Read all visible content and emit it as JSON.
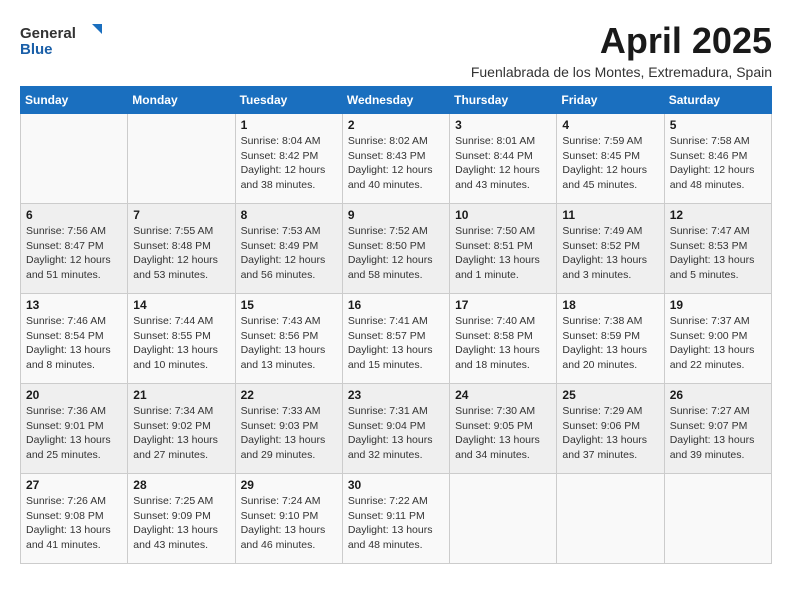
{
  "header": {
    "logo_general": "General",
    "logo_blue": "Blue",
    "month_title": "April 2025",
    "location": "Fuenlabrada de los Montes, Extremadura, Spain"
  },
  "weekdays": [
    "Sunday",
    "Monday",
    "Tuesday",
    "Wednesday",
    "Thursday",
    "Friday",
    "Saturday"
  ],
  "weeks": [
    [
      {
        "day": "",
        "info": ""
      },
      {
        "day": "",
        "info": ""
      },
      {
        "day": "1",
        "info": "Sunrise: 8:04 AM\nSunset: 8:42 PM\nDaylight: 12 hours and 38 minutes."
      },
      {
        "day": "2",
        "info": "Sunrise: 8:02 AM\nSunset: 8:43 PM\nDaylight: 12 hours and 40 minutes."
      },
      {
        "day": "3",
        "info": "Sunrise: 8:01 AM\nSunset: 8:44 PM\nDaylight: 12 hours and 43 minutes."
      },
      {
        "day": "4",
        "info": "Sunrise: 7:59 AM\nSunset: 8:45 PM\nDaylight: 12 hours and 45 minutes."
      },
      {
        "day": "5",
        "info": "Sunrise: 7:58 AM\nSunset: 8:46 PM\nDaylight: 12 hours and 48 minutes."
      }
    ],
    [
      {
        "day": "6",
        "info": "Sunrise: 7:56 AM\nSunset: 8:47 PM\nDaylight: 12 hours and 51 minutes."
      },
      {
        "day": "7",
        "info": "Sunrise: 7:55 AM\nSunset: 8:48 PM\nDaylight: 12 hours and 53 minutes."
      },
      {
        "day": "8",
        "info": "Sunrise: 7:53 AM\nSunset: 8:49 PM\nDaylight: 12 hours and 56 minutes."
      },
      {
        "day": "9",
        "info": "Sunrise: 7:52 AM\nSunset: 8:50 PM\nDaylight: 12 hours and 58 minutes."
      },
      {
        "day": "10",
        "info": "Sunrise: 7:50 AM\nSunset: 8:51 PM\nDaylight: 13 hours and 1 minute."
      },
      {
        "day": "11",
        "info": "Sunrise: 7:49 AM\nSunset: 8:52 PM\nDaylight: 13 hours and 3 minutes."
      },
      {
        "day": "12",
        "info": "Sunrise: 7:47 AM\nSunset: 8:53 PM\nDaylight: 13 hours and 5 minutes."
      }
    ],
    [
      {
        "day": "13",
        "info": "Sunrise: 7:46 AM\nSunset: 8:54 PM\nDaylight: 13 hours and 8 minutes."
      },
      {
        "day": "14",
        "info": "Sunrise: 7:44 AM\nSunset: 8:55 PM\nDaylight: 13 hours and 10 minutes."
      },
      {
        "day": "15",
        "info": "Sunrise: 7:43 AM\nSunset: 8:56 PM\nDaylight: 13 hours and 13 minutes."
      },
      {
        "day": "16",
        "info": "Sunrise: 7:41 AM\nSunset: 8:57 PM\nDaylight: 13 hours and 15 minutes."
      },
      {
        "day": "17",
        "info": "Sunrise: 7:40 AM\nSunset: 8:58 PM\nDaylight: 13 hours and 18 minutes."
      },
      {
        "day": "18",
        "info": "Sunrise: 7:38 AM\nSunset: 8:59 PM\nDaylight: 13 hours and 20 minutes."
      },
      {
        "day": "19",
        "info": "Sunrise: 7:37 AM\nSunset: 9:00 PM\nDaylight: 13 hours and 22 minutes."
      }
    ],
    [
      {
        "day": "20",
        "info": "Sunrise: 7:36 AM\nSunset: 9:01 PM\nDaylight: 13 hours and 25 minutes."
      },
      {
        "day": "21",
        "info": "Sunrise: 7:34 AM\nSunset: 9:02 PM\nDaylight: 13 hours and 27 minutes."
      },
      {
        "day": "22",
        "info": "Sunrise: 7:33 AM\nSunset: 9:03 PM\nDaylight: 13 hours and 29 minutes."
      },
      {
        "day": "23",
        "info": "Sunrise: 7:31 AM\nSunset: 9:04 PM\nDaylight: 13 hours and 32 minutes."
      },
      {
        "day": "24",
        "info": "Sunrise: 7:30 AM\nSunset: 9:05 PM\nDaylight: 13 hours and 34 minutes."
      },
      {
        "day": "25",
        "info": "Sunrise: 7:29 AM\nSunset: 9:06 PM\nDaylight: 13 hours and 37 minutes."
      },
      {
        "day": "26",
        "info": "Sunrise: 7:27 AM\nSunset: 9:07 PM\nDaylight: 13 hours and 39 minutes."
      }
    ],
    [
      {
        "day": "27",
        "info": "Sunrise: 7:26 AM\nSunset: 9:08 PM\nDaylight: 13 hours and 41 minutes."
      },
      {
        "day": "28",
        "info": "Sunrise: 7:25 AM\nSunset: 9:09 PM\nDaylight: 13 hours and 43 minutes."
      },
      {
        "day": "29",
        "info": "Sunrise: 7:24 AM\nSunset: 9:10 PM\nDaylight: 13 hours and 46 minutes."
      },
      {
        "day": "30",
        "info": "Sunrise: 7:22 AM\nSunset: 9:11 PM\nDaylight: 13 hours and 48 minutes."
      },
      {
        "day": "",
        "info": ""
      },
      {
        "day": "",
        "info": ""
      },
      {
        "day": "",
        "info": ""
      }
    ]
  ]
}
